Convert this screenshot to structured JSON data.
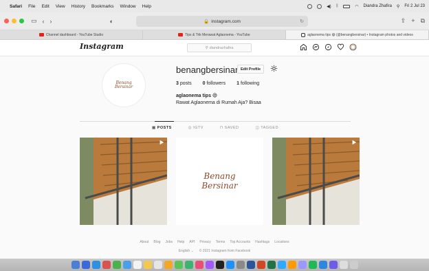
{
  "menubar": {
    "app": "Safari",
    "items": [
      "File",
      "Edit",
      "View",
      "History",
      "Bookmarks",
      "Window",
      "Help"
    ],
    "user": "Diandra Zhafira",
    "clock": "Fri 2 Jul 23"
  },
  "browser": {
    "url": "instagram.com",
    "tabs": [
      {
        "label": "Channel dashboard - YouTube Studio",
        "icon": "youtube-icon"
      },
      {
        "label": "Tips & Trik Merawat Aglaonema - YouTube",
        "icon": "youtube-icon"
      },
      {
        "label": "aglaonema tips 😄 (@benangbersinar) • Instagram photos and videos",
        "icon": "instagram-icon"
      }
    ]
  },
  "header": {
    "logo": "Instagram",
    "search_placeholder": "diandrazhafira"
  },
  "profile": {
    "username": "benangbersinar",
    "edit_label": "Edit Profile",
    "posts_count": "3",
    "posts_label": "posts",
    "followers_count": "0",
    "followers_label": "followers",
    "following_count": "1",
    "following_label": "following",
    "name": "aglaonema tips 😄",
    "bio": "Rawat Aglaonema di Rumah Aja? Bisaa",
    "avatar_text_1": "Benang",
    "avatar_text_2": "Bersinar"
  },
  "profile_tabs": [
    "POSTS",
    "IGTV",
    "SAVED",
    "TAGGED"
  ],
  "post_center": {
    "line1": "Benang",
    "line2": "Bersinar"
  },
  "footer": {
    "links": [
      "About",
      "Blog",
      "Jobs",
      "Help",
      "API",
      "Privacy",
      "Terms",
      "Top Accounts",
      "Hashtags",
      "Locations"
    ],
    "language": "English",
    "copyright": "© 2021 Instagram from Facebook"
  },
  "colors": {
    "brand_brown": "#8a4a2a",
    "wood": "#b97a3c"
  }
}
